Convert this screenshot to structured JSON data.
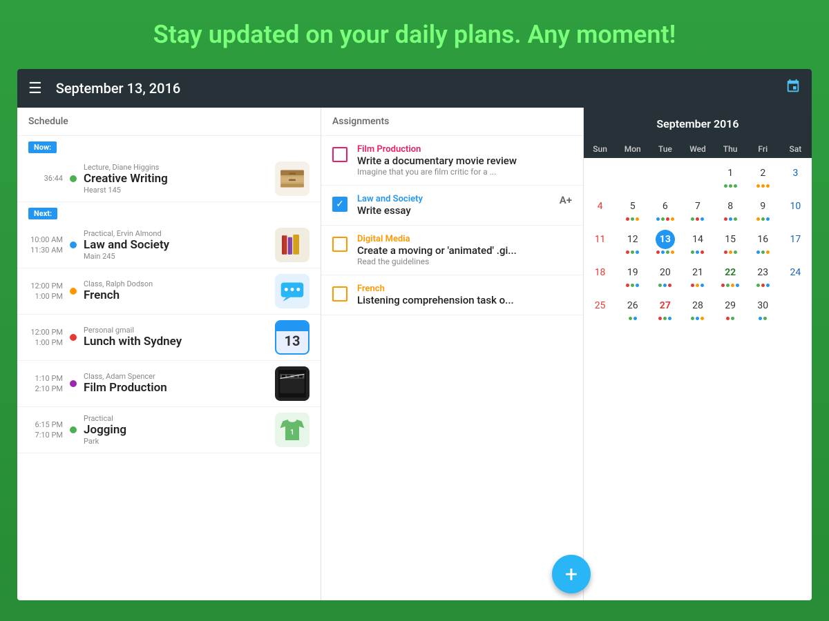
{
  "banner": {
    "text_white": "Stay updated on your daily plans.",
    "text_green": "Any moment!"
  },
  "toolbar": {
    "title": "September 13, 2016",
    "menu_icon": "☰",
    "calendar_icon": "📅"
  },
  "schedule": {
    "header": "Schedule",
    "now_badge": "Now:",
    "next_badge": "Next:",
    "items": [
      {
        "time_start": "36:44",
        "subtitle": "Lecture, Diane Higgins",
        "name": "Creative Writing",
        "location": "Hearst 145",
        "dot_color": "#4CAF50",
        "icon": "🗃️",
        "icon_bg": "icon-filing",
        "badge": "now"
      },
      {
        "time_start": "10:00 AM",
        "time_end": "11:30 AM",
        "subtitle": "Practical, Ervin Almond",
        "name": "Law and Society",
        "location": "Main 245",
        "dot_color": "#2196F3",
        "icon": "📚",
        "icon_bg": "icon-books",
        "badge": "next"
      },
      {
        "time_start": "12:00 PM",
        "time_end": "1:00 PM",
        "subtitle": "Class, Ralph Dodson",
        "name": "French",
        "location": "",
        "dot_color": "#FF9800",
        "icon": "💬",
        "icon_bg": "icon-chat"
      },
      {
        "time_start": "12:00 PM",
        "time_end": "1:00 PM",
        "subtitle": "Personal gmail",
        "name": "Lunch with Sydney",
        "location": "",
        "dot_color": "#e53935",
        "icon": "13",
        "icon_bg": "icon-calendar",
        "is_calendar": true
      },
      {
        "time_start": "1:10 PM",
        "time_end": "2:10 PM",
        "subtitle": "Class, Adam Spencer",
        "name": "Film Production",
        "location": "",
        "dot_color": "#9C27B0",
        "icon": "🎬",
        "icon_bg": "icon-film"
      },
      {
        "time_start": "6:15 PM",
        "time_end": "7:10 PM",
        "subtitle": "Practical",
        "name": "Jogging",
        "location": "Park",
        "dot_color": "#4CAF50",
        "icon": "👕",
        "icon_bg": "icon-tshirt"
      }
    ]
  },
  "assignments": {
    "header": "Assignments",
    "items": [
      {
        "category": "Film Production",
        "category_color": "#E91E63",
        "title": "Write a documentary movie review",
        "desc": "Imagine that you are film critic for a ...",
        "checked": false,
        "checkbox_type": "pink"
      },
      {
        "category": "Law and Society",
        "category_color": "#2196F3",
        "title": "Write essay",
        "desc": "",
        "grade": "A+",
        "checked": true,
        "checkbox_type": "checked"
      },
      {
        "category": "Digital Media",
        "category_color": "#FF9800",
        "title": "Create a moving or 'animated' .gi...",
        "desc": "Read the guidelines",
        "checked": false,
        "checkbox_type": "orange"
      },
      {
        "category": "French",
        "category_color": "#FF9800",
        "title": "Listening comprehension task o...",
        "desc": "",
        "checked": false,
        "checkbox_type": "orange"
      }
    ]
  },
  "calendar": {
    "header": "September 2016",
    "day_names": [
      "Sun",
      "Mon",
      "Tue",
      "Wed",
      "Thu",
      "Fri",
      "Sat"
    ],
    "weeks": [
      [
        {
          "date": "",
          "type": "empty"
        },
        {
          "date": "",
          "type": "empty"
        },
        {
          "date": "",
          "type": "empty"
        },
        {
          "date": "",
          "type": "empty"
        },
        {
          "date": "1",
          "type": "normal",
          "dots": [
            "#4CAF50",
            "#4CAF50",
            "#4CAF50"
          ]
        },
        {
          "date": "2",
          "type": "normal",
          "dots": [
            "#FF9800",
            "#FF9800",
            "#FF9800"
          ]
        },
        {
          "date": "3",
          "type": "sat",
          "dots": []
        }
      ],
      [
        {
          "date": "4",
          "type": "sun",
          "dots": []
        },
        {
          "date": "5",
          "type": "normal",
          "dots": [
            "#e53935",
            "#4CAF50",
            "#FF9800"
          ]
        },
        {
          "date": "6",
          "type": "normal",
          "dots": [
            "#2196F3",
            "#4CAF50",
            "#e53935",
            "#FF9800"
          ]
        },
        {
          "date": "7",
          "type": "normal",
          "dots": [
            "#4CAF50",
            "#e53935",
            "#2196F3"
          ]
        },
        {
          "date": "8",
          "type": "normal",
          "dots": [
            "#e53935",
            "#2196F3",
            "#4CAF50"
          ]
        },
        {
          "date": "9",
          "type": "normal",
          "dots": [
            "#FF9800",
            "#4CAF50",
            "#2196F3"
          ]
        },
        {
          "date": "10",
          "type": "sat",
          "dots": []
        }
      ],
      [
        {
          "date": "11",
          "type": "sun",
          "dots": []
        },
        {
          "date": "12",
          "type": "normal",
          "dots": [
            "#e53935",
            "#4CAF50",
            "#2196F3"
          ]
        },
        {
          "date": "13",
          "type": "today",
          "dots": [
            "#e53935",
            "#2196F3",
            "#4CAF50",
            "#FF9800"
          ]
        },
        {
          "date": "14",
          "type": "normal",
          "dots": [
            "#4CAF50",
            "#2196F3",
            "#e53935"
          ]
        },
        {
          "date": "15",
          "type": "normal",
          "dots": [
            "#e53935",
            "#FF9800",
            "#4CAF50"
          ]
        },
        {
          "date": "16",
          "type": "normal",
          "dots": [
            "#2196F3",
            "#4CAF50",
            "#FF9800"
          ]
        },
        {
          "date": "17",
          "type": "sat",
          "dots": []
        }
      ],
      [
        {
          "date": "18",
          "type": "sun",
          "dots": []
        },
        {
          "date": "19",
          "type": "normal",
          "dots": [
            "#e53935",
            "#4CAF50",
            "#2196F3"
          ]
        },
        {
          "date": "20",
          "type": "normal",
          "dots": [
            "#4CAF50",
            "#2196F3",
            "#e53935"
          ]
        },
        {
          "date": "21",
          "type": "normal",
          "dots": [
            "#e53935",
            "#FF9800",
            "#2196F3"
          ]
        },
        {
          "date": "22",
          "type": "bold-green",
          "dots": [
            "#e53935",
            "#4CAF50",
            "#FF9800",
            "#2196F3"
          ]
        },
        {
          "date": "23",
          "type": "normal",
          "dots": [
            "#4CAF50",
            "#e53935",
            "#2196F3"
          ]
        },
        {
          "date": "24",
          "type": "sat",
          "dots": []
        }
      ],
      [
        {
          "date": "25",
          "type": "sun",
          "dots": []
        },
        {
          "date": "26",
          "type": "normal",
          "dots": [
            "#4CAF50",
            "#2196F3"
          ]
        },
        {
          "date": "27",
          "type": "special-red",
          "dots": [
            "#e53935",
            "#4CAF50",
            "#2196F3"
          ]
        },
        {
          "date": "28",
          "type": "normal",
          "dots": [
            "#4CAF50",
            "#2196F3",
            "#FF9800"
          ]
        },
        {
          "date": "29",
          "type": "normal",
          "dots": [
            "#e53935",
            "#4CAF50"
          ]
        },
        {
          "date": "30",
          "type": "normal",
          "dots": [
            "#2196F3",
            "#4CAF50"
          ]
        },
        {
          "date": "",
          "type": "empty",
          "dots": []
        }
      ]
    ]
  },
  "fab": {
    "label": "+"
  }
}
